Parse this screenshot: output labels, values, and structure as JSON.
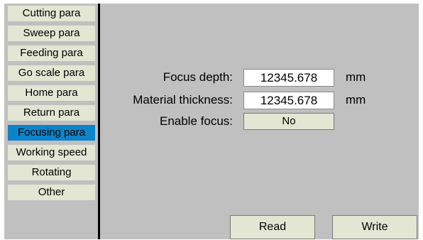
{
  "sidebar": {
    "items": [
      {
        "label": "Cutting para",
        "active": false
      },
      {
        "label": "Sweep para",
        "active": false
      },
      {
        "label": "Feeding para",
        "active": false
      },
      {
        "label": "Go scale para",
        "active": false
      },
      {
        "label": "Home para",
        "active": false
      },
      {
        "label": "Return para",
        "active": false
      },
      {
        "label": "Focusing para",
        "active": true
      },
      {
        "label": "Working speed",
        "active": false
      },
      {
        "label": "Rotating",
        "active": false
      },
      {
        "label": "Other",
        "active": false
      }
    ]
  },
  "form": {
    "focus_depth": {
      "label": "Focus depth:",
      "value": "12345.678",
      "unit": "mm"
    },
    "material_thickness": {
      "label": "Material thickness:",
      "value": "12345.678",
      "unit": "mm"
    },
    "enable_focus": {
      "label": "Enable focus:",
      "value": "No"
    }
  },
  "actions": {
    "read_label": "Read",
    "write_label": "Write"
  },
  "colors": {
    "background": "#c0c0c0",
    "button": "#e2e6d3",
    "active_item": "#0b84c9",
    "divider": "#000000"
  }
}
